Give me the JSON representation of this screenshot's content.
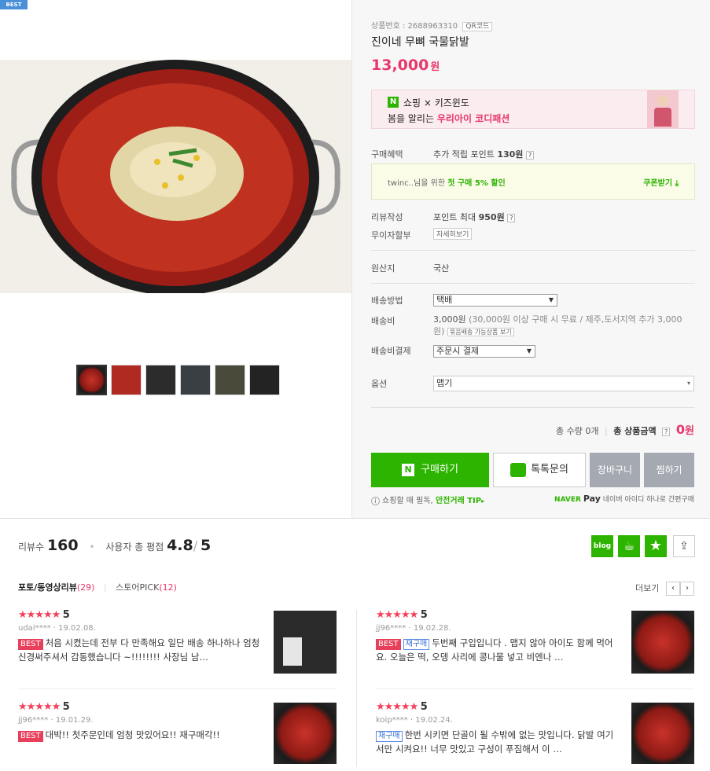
{
  "badge": "BEST",
  "product": {
    "no_label": "상품번호 :",
    "no": "2688963310",
    "qr": "QR코드",
    "title": "진이네 무뼈 국물닭발",
    "price": "13,000",
    "unit": "원"
  },
  "banner": {
    "n": "N",
    "brand": "쇼핑 × 키즈윈도",
    "line_a": "봄을 알리는 ",
    "line_b": "우리아이 코디패션"
  },
  "benefit": {
    "label": "구매혜택",
    "text": "추가 적립 포인트",
    "points": "130원",
    "help": "?"
  },
  "coupon": {
    "user": "twinc..님을 위한",
    "offer": "첫 구매 5% 할인",
    "btn": "쿠폰받기"
  },
  "review_write": {
    "label": "리뷰작성",
    "text": "포인트 최대",
    "points": "950원",
    "help": "?"
  },
  "installment": {
    "label": "무이자할부",
    "btn": "자세히보기"
  },
  "origin": {
    "label": "원산지",
    "value": "국산"
  },
  "shipping": {
    "label": "배송방법",
    "value": "택배",
    "fee_label": "배송비",
    "fee": "3,000원",
    "fee_note": "(30,000원 이상 구매 시 무료 / 제주,도서지역 추가 3,000원)",
    "fee_btn": "묶음배송 가능상품 보기",
    "pay_label": "배송비결제",
    "pay_value": "주문시 결제"
  },
  "option": {
    "label": "옵션",
    "value": "맵기"
  },
  "total": {
    "qty": "총 수량 0개",
    "sum_label": "총 상품금액",
    "help": "?",
    "amount": "0",
    "unit": "원"
  },
  "buttons": {
    "buy": "구매하기",
    "talk": "톡톡문의",
    "cart": "장바구니",
    "wish": "찜하기"
  },
  "safe": {
    "pre": "쇼핑할 때 필독,",
    "link": "안전거래 TIP",
    "arrow": "▸",
    "npay": "NAVER",
    "npay2": "Pay",
    "npay_note": "네이버 아이디 하나로 간편구매"
  },
  "reviews": {
    "count_label": "리뷰수",
    "count": "160",
    "score_label": "사용자 총 평점",
    "score": "4.8",
    "max": "5",
    "blog": "blog",
    "tab1": "포토/동영상리뷰",
    "tab1_n": "(29)",
    "tab2": "스토어PICK",
    "tab2_n": "(12)",
    "more": "더보기",
    "items": [
      {
        "score": "5",
        "user": "udal****",
        "date": "19.02.08.",
        "best": "BEST",
        "re": "",
        "text": "처음 시켰는데 전부 다 만족해요 일단 배송 하나하나 엄청 신경써주셔서 감동했습니다 ~!!!!!!!! 사장님 남…"
      },
      {
        "score": "5",
        "user": "jj96****",
        "date": "19.02.28.",
        "best": "BEST",
        "re": "재구매",
        "text": "두번째 구입입니다 . 맵지 않아 아이도 함께 먹어요. 오늘은 떡, 오뎅 사리에 콩나물 넣고 비엔나 …"
      },
      {
        "score": "5",
        "user": "jj96****",
        "date": "19.01.29.",
        "best": "BEST",
        "re": "",
        "text": "대박!! 첫주문인데 엄청 맛있어요!! 재구매각!!"
      },
      {
        "score": "5",
        "user": "koip****",
        "date": "19.02.24.",
        "best": "",
        "re": "재구매",
        "text": "한번 시키면 단골이 될 수밖에 없는 맛입니다. 닭발 여기서만 시켜요!! 너무 맛있고 구성이 푸짐해서 이 …"
      }
    ]
  }
}
